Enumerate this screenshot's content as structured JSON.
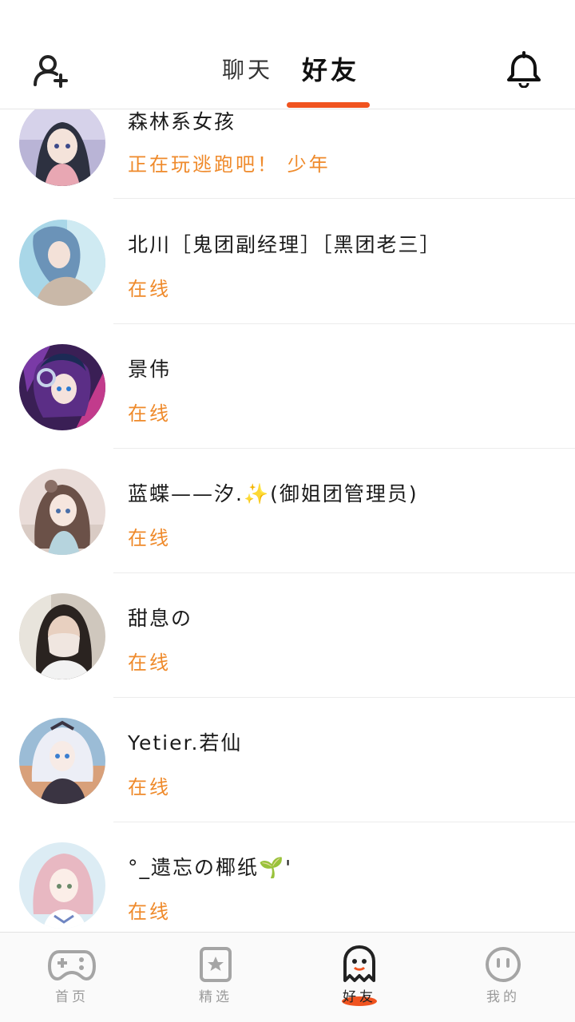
{
  "header": {
    "tabs": [
      "聊天",
      "好友"
    ],
    "active_tab": "好友",
    "left_icon": "add-friend-icon",
    "right_icon": "bell-icon",
    "accent": "#f0531f"
  },
  "friends": [
    {
      "name": "森林系女孩",
      "status": "正在玩逃跑吧！ 少年",
      "avatar": "anime-girl-dark-hair"
    },
    {
      "name": "北川［鬼团副经理］［黑团老三］",
      "status": "在线",
      "avatar": "anime-girl-blue-hair"
    },
    {
      "name": "景伟",
      "status": "在线",
      "avatar": "anime-girl-purple-headphones"
    },
    {
      "name": "蓝蝶——汐.✨(御姐团管理员)",
      "status": "在线",
      "avatar": "anime-girl-brown-hair"
    },
    {
      "name": "甜息の",
      "status": "在线",
      "avatar": "photo-girl-mask"
    },
    {
      "name": "Yetier.若仙",
      "status": "在线",
      "avatar": "anime-girl-white-hair"
    },
    {
      "name": "°_遗忘の椰纸🌱'",
      "status": "在线",
      "avatar": "anime-girl-pink-hair"
    }
  ],
  "colors": {
    "status": "#ef8a2b",
    "divider": "#ececec"
  },
  "tabbar": {
    "items": [
      {
        "label": "首页",
        "icon": "gamepad-icon"
      },
      {
        "label": "精选",
        "icon": "star-bookmark-icon"
      },
      {
        "label": "好友",
        "icon": "ghost-icon"
      },
      {
        "label": "我的",
        "icon": "face-icon"
      }
    ],
    "active": "好友"
  }
}
